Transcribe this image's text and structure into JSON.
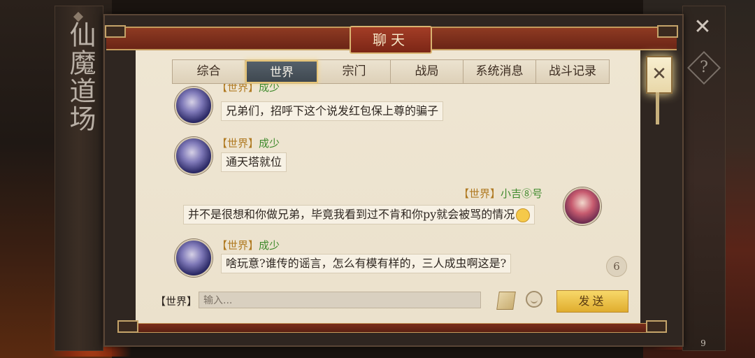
{
  "side_banner": {
    "title": "仙魔道场"
  },
  "dialog": {
    "title": "聊天"
  },
  "tabs": [
    {
      "label": "综合"
    },
    {
      "label": "世界"
    },
    {
      "label": "宗门"
    },
    {
      "label": "战局"
    },
    {
      "label": "系统消息"
    },
    {
      "label": "战斗记录"
    }
  ],
  "active_tab": "世界",
  "messages": [
    {
      "channel": "【世界】",
      "sender": "成少",
      "text": "兄弟们，招呼下这个说发红包保上尊的骗子",
      "side": "left"
    },
    {
      "channel": "【世界】",
      "sender": "成少",
      "text": "通天塔就位",
      "side": "left"
    },
    {
      "channel": "【世界】",
      "sender": "小吉⑧号",
      "text": "并不是很想和你做兄弟，毕竟我看到过不肯和你py就会被骂的情况",
      "side": "right"
    },
    {
      "channel": "【世界】",
      "sender": "成少",
      "text": "啥玩意?谁传的谣言，怎么有模有样的，三人成虫啊这是?",
      "side": "left"
    }
  ],
  "unread_count": "6",
  "input": {
    "channel_label": "【世界】",
    "placeholder": "输入..."
  },
  "send_button": {
    "label": "发送"
  },
  "right_panel": {
    "badge_count": "9"
  },
  "colors": {
    "channel": "#b07a22",
    "sender": "#3f8a2c",
    "active_tab_glow": "#e9c77a",
    "send_button": "#f2c84b"
  },
  "icons": [
    "close-icon",
    "help-icon",
    "book-icon",
    "emoji-icon",
    "lantern-close-icon"
  ]
}
